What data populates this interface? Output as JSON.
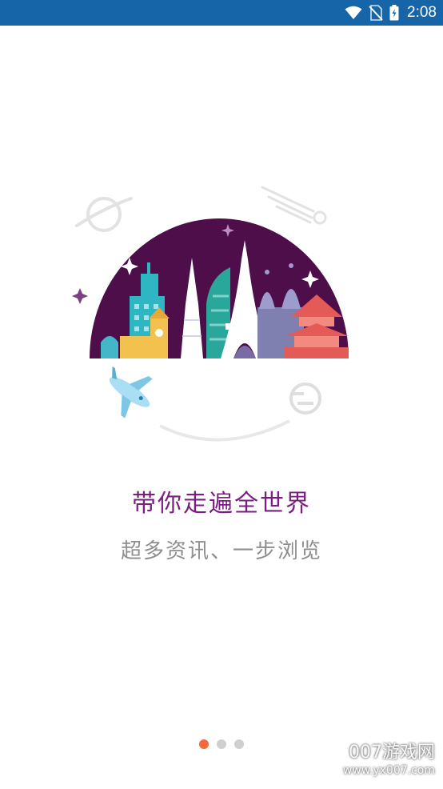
{
  "status_bar": {
    "time": "2:08",
    "icons": [
      "wifi-icon",
      "no-sim-icon",
      "battery-charging-icon"
    ],
    "background": "#1565a8"
  },
  "onboarding": {
    "headline": "带你走遍全世界",
    "subline": "超多资讯、一步浏览",
    "headline_color": "#7a1f80",
    "subline_color": "#8e8e8e",
    "illustration": "city-skyline-globe-illustration"
  },
  "pager": {
    "total": 3,
    "current": 1,
    "active_color": "#f26a3d",
    "inactive_color": "#cfcfcf"
  },
  "watermark": {
    "brand": "007游戏网",
    "url": "www.yx007.com"
  }
}
